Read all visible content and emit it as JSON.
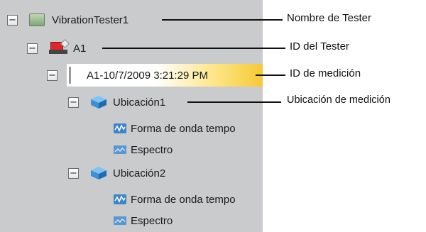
{
  "tree": {
    "tester": {
      "label": "VibrationTester1",
      "toggle": "−"
    },
    "tester_id": {
      "label": "A1",
      "toggle": "−"
    },
    "measurement": {
      "label": "A1-10/7/2009 3:21:29 PM",
      "toggle": "−"
    },
    "locations": [
      {
        "label": "Ubicación1",
        "toggle": "−",
        "children": [
          {
            "label": "Forma de onda tempo",
            "icon": "waveform-icon"
          },
          {
            "label": "Espectro",
            "icon": "spectrum-icon"
          }
        ]
      },
      {
        "label": "Ubicación2",
        "toggle": "−",
        "children": [
          {
            "label": "Forma de onda tempo",
            "icon": "waveform-icon"
          },
          {
            "label": "Espectro",
            "icon": "spectrum-icon"
          }
        ]
      }
    ]
  },
  "callouts": [
    "Nombre de Tester",
    "ID del Tester",
    "ID de medición",
    "Ubicación de medición"
  ],
  "colors": {
    "panel_bg": "#c9cbcd",
    "highlight": "#f6c934",
    "cube_blue": "#3d8fd6"
  }
}
